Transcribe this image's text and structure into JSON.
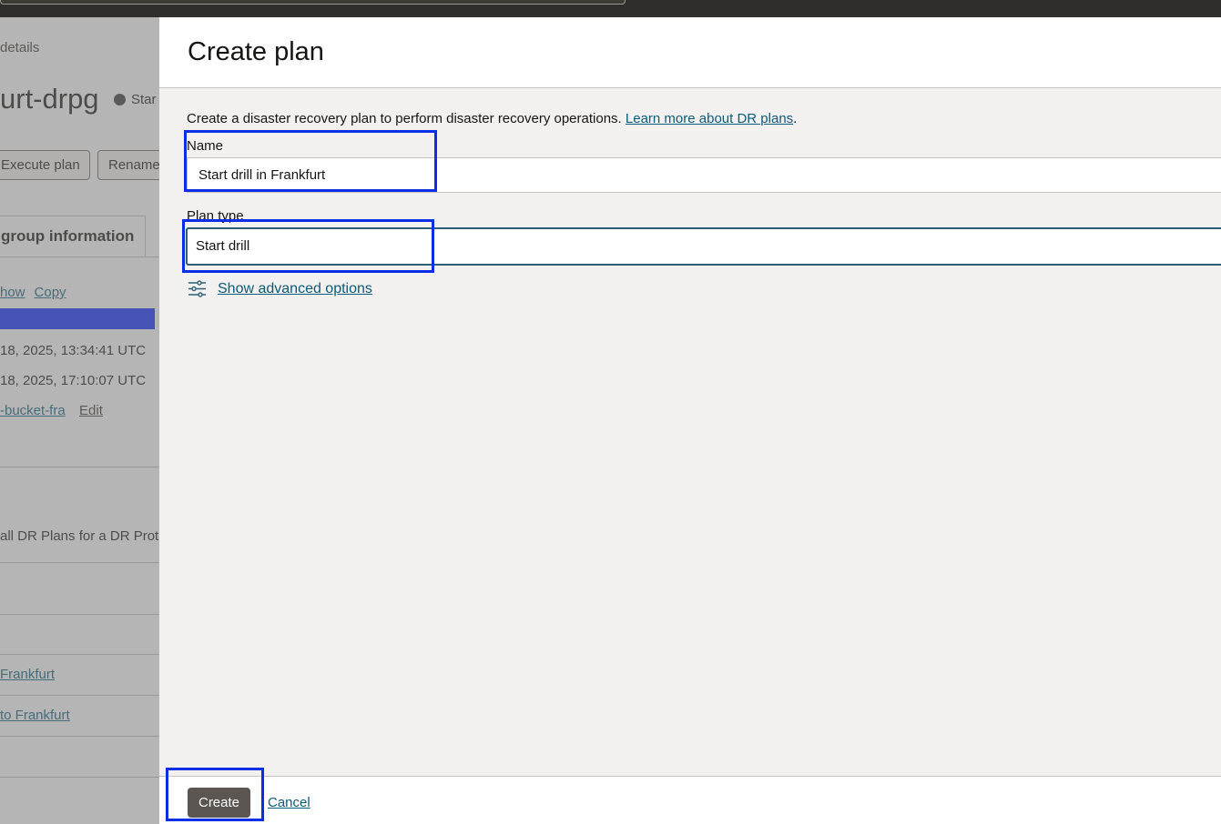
{
  "background": {
    "breadcrumb": "details",
    "title": "urt-drpg",
    "status": "Star",
    "buttons": {
      "execute": "Execute plan",
      "rename": "Rename"
    },
    "tab": "group information",
    "links": {
      "show": "how",
      "copy": "Copy",
      "edit": "Edit"
    },
    "rows": {
      "created": "18, 2025, 13:34:41 UTC",
      "updated": "18, 2025, 17:10:07 UTC",
      "bucket": "-bucket-fra",
      "plans_desc": "all DR Plans for a DR Prot",
      "plan1": "Frankfurt",
      "plan2": "to Frankfurt"
    }
  },
  "panel": {
    "title": "Create plan",
    "description": "Create a disaster recovery plan to perform disaster recovery operations.",
    "learn_more": "Learn more about DR plans",
    "name_label": "Name",
    "name_value": "Start drill in Frankfurt",
    "plan_type_label": "Plan type",
    "plan_type_value": "Start drill",
    "advanced_options": "Show advanced options",
    "create_label": "Create",
    "cancel_label": "Cancel"
  },
  "colors": {
    "accent": "#0a5c7a",
    "highlight": "#0a2ee6",
    "primary_button": "#5b5652"
  },
  "icons": {
    "advanced": "sliders-icon",
    "status": "status-dot-icon"
  }
}
